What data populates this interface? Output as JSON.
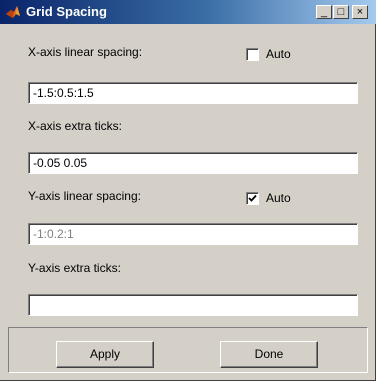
{
  "window": {
    "title": "Grid Spacing",
    "minimize_glyph": "_",
    "maximize_glyph": "□",
    "close_glyph": "×",
    "icon": "matlab-icon"
  },
  "x_linear": {
    "label": "X-axis linear spacing:",
    "auto_label": "Auto",
    "auto_checked": false,
    "value": "-1.5:0.5:1.5"
  },
  "x_extra": {
    "label": "X-axis extra ticks:",
    "value": "-0.05 0.05"
  },
  "y_linear": {
    "label": "Y-axis linear spacing:",
    "auto_label": "Auto",
    "auto_checked": true,
    "value": "-1:0.2:1"
  },
  "y_extra": {
    "label": "Y-axis extra ticks:",
    "value": ""
  },
  "buttons": {
    "apply": "Apply",
    "done": "Done"
  },
  "colors": {
    "titlebar_start": "#0a246a",
    "titlebar_end": "#a6caf0",
    "face": "#d4d0c8"
  }
}
